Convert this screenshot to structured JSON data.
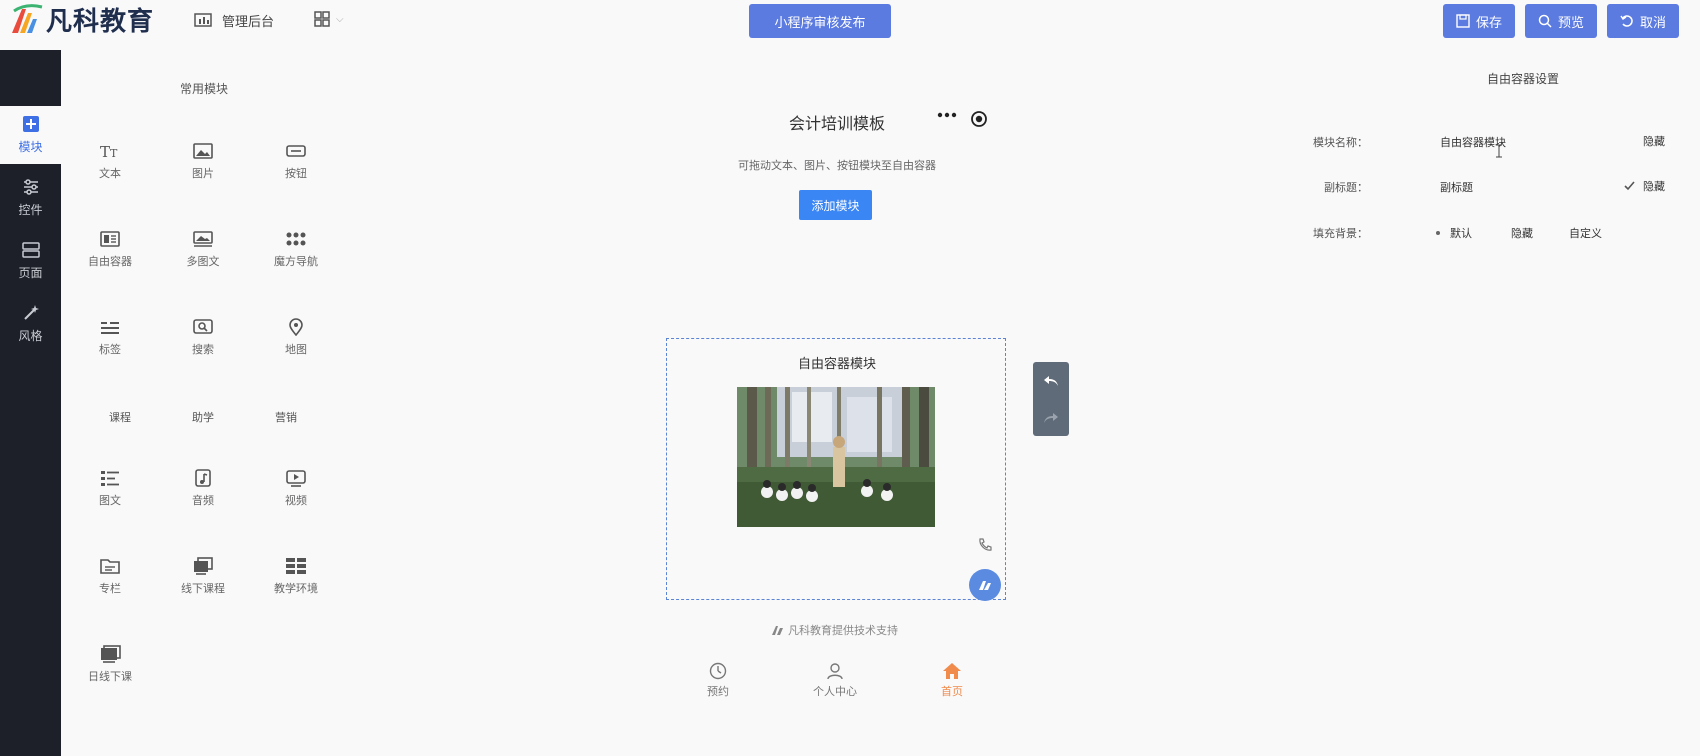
{
  "header": {
    "logo_text": "凡科教育",
    "admin_label": "管理后台",
    "publish_label": "小程序审核发布",
    "save_label": "保存",
    "preview_label": "预览",
    "cancel_label": "取消",
    "accent_color": "#5b7be0"
  },
  "sidebar": {
    "items": [
      {
        "label": "模块",
        "icon": "plus-square-icon",
        "active": true
      },
      {
        "label": "控件",
        "icon": "sliders-icon"
      },
      {
        "label": "页面",
        "icon": "pages-icon"
      },
      {
        "label": "风格",
        "icon": "magic-wand-icon"
      }
    ]
  },
  "modules": {
    "title": "常用模块",
    "items": [
      {
        "label": "文本",
        "icon": "text-icon"
      },
      {
        "label": "图片",
        "icon": "image-icon"
      },
      {
        "label": "按钮",
        "icon": "button-icon"
      },
      {
        "label": "自由容器",
        "icon": "container-icon"
      },
      {
        "label": "多图文",
        "icon": "multi-image-icon"
      },
      {
        "label": "魔方导航",
        "icon": "dots-grid-icon"
      },
      {
        "label": "标签",
        "icon": "tag-lines-icon"
      },
      {
        "label": "搜索",
        "icon": "search-icon"
      },
      {
        "label": "地图",
        "icon": "map-pin-icon"
      },
      {
        "label": "课程",
        "icon": ""
      },
      {
        "label": "助学",
        "icon": ""
      },
      {
        "label": "营销",
        "icon": ""
      },
      {
        "label": "图文",
        "icon": "list-icon"
      },
      {
        "label": "音频",
        "icon": "music-icon"
      },
      {
        "label": "视频",
        "icon": "video-icon"
      },
      {
        "label": "专栏",
        "icon": "folder-icon"
      },
      {
        "label": "线下课程",
        "icon": "offline-course-icon"
      },
      {
        "label": "教学环境",
        "icon": "grid-icon"
      },
      {
        "label": "日线下课",
        "icon": "calendar-class-icon"
      }
    ]
  },
  "canvas": {
    "page_title": "会计培训模板",
    "drag_hint": "可拖动文本、图片、按钮模块至自由容器",
    "add_module_label": "添加模块",
    "container_title": "自由容器模块",
    "tech_support": "凡科教育提供技术支持",
    "tabs": [
      {
        "label": "预约",
        "icon": "clock-icon"
      },
      {
        "label": "个人中心",
        "icon": "user-icon"
      },
      {
        "label": "首页",
        "icon": "home-icon",
        "active": true
      }
    ]
  },
  "settings": {
    "title": "自由容器设置",
    "name_label": "模块名称：",
    "name_value": "自由容器模块",
    "name_hide": "隐藏",
    "subtitle_label": "副标题：",
    "subtitle_value": "副标题",
    "subtitle_hide": "隐藏",
    "fill_label": "填充背景：",
    "fill_options": [
      "默认",
      "隐藏",
      "自定义"
    ],
    "fill_selected": "默认"
  }
}
